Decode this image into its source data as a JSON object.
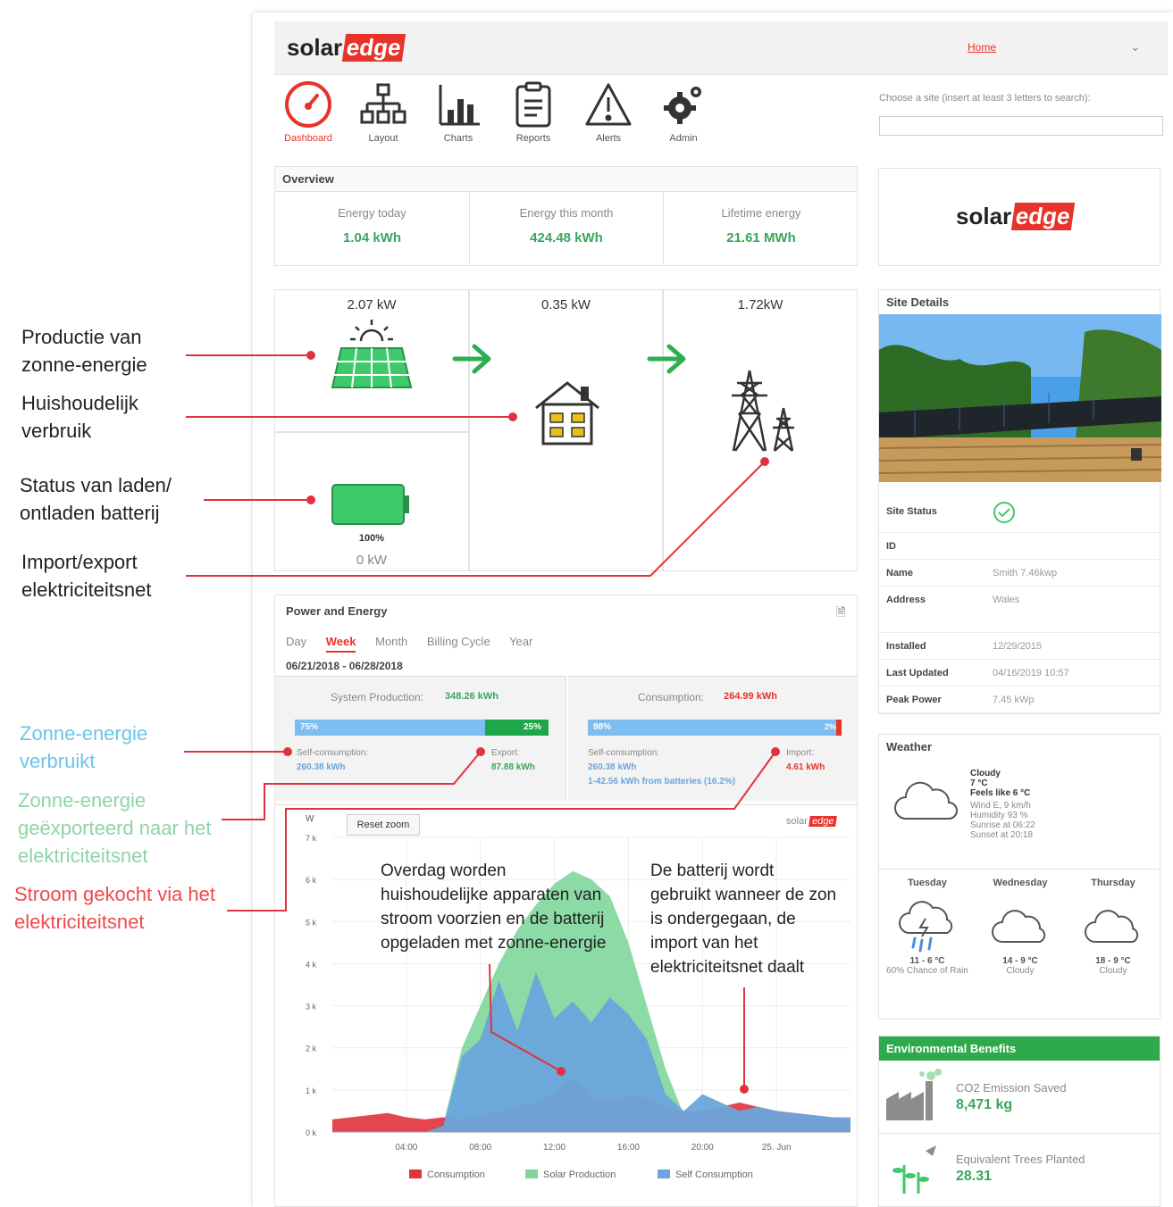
{
  "header": {
    "logo_solar": "solar",
    "logo_edge": "edge",
    "home_link": "Home"
  },
  "nav": [
    {
      "label": "Dashboard",
      "icon": "dashboard-gauge-icon",
      "active": true
    },
    {
      "label": "Layout",
      "icon": "layout-tree-icon"
    },
    {
      "label": "Charts",
      "icon": "bar-chart-icon"
    },
    {
      "label": "Reports",
      "icon": "clipboard-icon"
    },
    {
      "label": "Alerts",
      "icon": "warning-triangle-icon"
    },
    {
      "label": "Admin",
      "icon": "gears-icon"
    }
  ],
  "site_search": {
    "label": "Choose a site (insert at least 3 letters to search):",
    "value": ""
  },
  "overview": {
    "title": "Overview",
    "energy_today_label": "Energy today",
    "energy_today": "1.04 kWh",
    "energy_month_label": "Energy this month",
    "energy_month": "424.48 kWh",
    "lifetime_label": "Lifetime energy",
    "lifetime": "21.61 MWh"
  },
  "flow": {
    "solar_kw": "2.07 kW",
    "house_kw": "0.35 kW",
    "grid_kw": "1.72kW",
    "battery_pct": "100%",
    "battery_kw": "0 kW",
    "battery_level": 1.0
  },
  "power_energy": {
    "title": "Power and Energy",
    "tabs": [
      "Day",
      "Week",
      "Month",
      "Billing Cycle",
      "Year"
    ],
    "active_tab": "Week",
    "date_range": "06/21/2018 - 06/28/2018",
    "system_production_label": "System Production:",
    "system_production_value": "348.26 kWh",
    "prod_self_pct_label": "75%",
    "prod_self_fraction": 0.75,
    "prod_export_pct_label": "25%",
    "self_consumption_label": "Self-consumption:",
    "self_consumption_value": "260.38 kWh",
    "export_label": "Export:",
    "export_value": "87.88 kWh",
    "consumption_label": "Consumption:",
    "consumption_value": "264.99 kWh",
    "cons_self_pct_label": "98%",
    "cons_self_fraction": 0.98,
    "cons_import_pct_label": "2%",
    "cons_self_consumption_label": "Self-consumption:",
    "cons_self_consumption_value": "260.38 kWh",
    "cons_battery_note": "1-42.56 kWh from batteries (16.2%)",
    "import_label": "Import:",
    "import_value": "4.61 kWh",
    "reset_zoom": "Reset zoom"
  },
  "chart_data": {
    "type": "area",
    "ylabel": "W",
    "y_ticks": [
      "7 k",
      "6 k",
      "5 k",
      "4 k",
      "3 k",
      "2 k",
      "1 k",
      "0 k"
    ],
    "ylim": [
      0,
      7000
    ],
    "x_ticks": [
      "04:00",
      "08:00",
      "12:00",
      "16:00",
      "20:00",
      "25. Jun"
    ],
    "x_hours": [
      0,
      1,
      2,
      3,
      4,
      5,
      6,
      7,
      8,
      9,
      10,
      11,
      12,
      13,
      14,
      15,
      16,
      17,
      18,
      19,
      20,
      21,
      22,
      23,
      24,
      25,
      26,
      27,
      28
    ],
    "series": [
      {
        "name": "Consumption",
        "color": "#e0323c",
        "values": [
          300,
          350,
          400,
          450,
          350,
          300,
          350,
          300,
          400,
          500,
          600,
          700,
          900,
          1300,
          800,
          700,
          900,
          800,
          600,
          500,
          500,
          600,
          700,
          600,
          500,
          450,
          400,
          350,
          300
        ]
      },
      {
        "name": "Solar Production",
        "color": "#7fd69b",
        "values": [
          0,
          0,
          0,
          0,
          0,
          0,
          200,
          2000,
          3000,
          4000,
          4800,
          5400,
          5900,
          6200,
          6000,
          5600,
          4500,
          3000,
          1500,
          400,
          0,
          0,
          0,
          0,
          0,
          0,
          0,
          0,
          0
        ]
      },
      {
        "name": "Self Consumption",
        "color": "#6aa5dc",
        "values": [
          0,
          0,
          0,
          0,
          0,
          0,
          150,
          1800,
          2200,
          3600,
          2400,
          3800,
          2700,
          3100,
          2600,
          3200,
          2800,
          2200,
          900,
          500,
          900,
          700,
          500,
          600,
          500,
          450,
          400,
          350,
          350
        ]
      }
    ],
    "legend": [
      "Consumption",
      "Solar Production",
      "Self Consumption"
    ],
    "legend_position": "bottom"
  },
  "site_details": {
    "title": "Site Details",
    "status_label": "Site Status",
    "rows": [
      {
        "k": "ID",
        "v": ""
      },
      {
        "k": "Name",
        "v": "Smith 7.46kwp"
      },
      {
        "k": "Address",
        "v": "Wales"
      },
      {
        "k": "Installed",
        "v": "12/29/2015"
      },
      {
        "k": "Last Updated",
        "v": "04/16/2019 10:57"
      },
      {
        "k": "Peak Power",
        "v": "7.45 kWp"
      }
    ]
  },
  "weather": {
    "title": "Weather",
    "now_cond": "Cloudy",
    "now_temp": "7 °C",
    "feels": "Feels like 6 °C",
    "wind": "Wind E, 9 km/h",
    "humidity": "Humidity 93 %",
    "sunrise": "Sunrise at 06:22",
    "sunset": "Sunset at 20:18",
    "days": [
      {
        "day": "Tuesday",
        "temp": "11 - 6 °C",
        "desc": "60% Chance of Rain",
        "icon": "rain-cloud-icon"
      },
      {
        "day": "Wednesday",
        "temp": "14 - 9 °C",
        "desc": "Cloudy",
        "icon": "cloud-icon"
      },
      {
        "day": "Thursday",
        "temp": "18 - 9 °C",
        "desc": "Cloudy",
        "icon": "cloud-icon"
      }
    ]
  },
  "env": {
    "title": "Environmental Benefits",
    "co2_label": "CO2 Emission Saved",
    "co2_value": "8,471 kg",
    "trees_label": "Equivalent Trees Planted",
    "trees_value": "28.31"
  },
  "annotations": {
    "a1": "Productie van zonne-energie",
    "a2": "Huishoudelijk verbruik",
    "a3": "Status van laden/ ontladen batterij",
    "a4": "Import/export elektriciteitsnet",
    "a5": "Zonne-energie verbruikt",
    "a6": "Zonne-energie geëxporteerd naar het elektriciteitsnet",
    "a7": "Stroom gekocht via het elektriciteitsnet",
    "callout_day": "Overdag worden huishoudelijke apparaten van stroom voorzien en de batterij opgeladen met zonne-energie",
    "callout_night": "De batterij wordt gebruikt wanneer de zon is ondergegaan, de import van het elektriciteitsnet daalt"
  },
  "colors": {
    "accent_red": "#e8332a",
    "green": "#3ba55c",
    "blue_annot": "#6cc4e8",
    "green_annot": "#8fd3a7",
    "red_annot": "#ef4a4a"
  }
}
